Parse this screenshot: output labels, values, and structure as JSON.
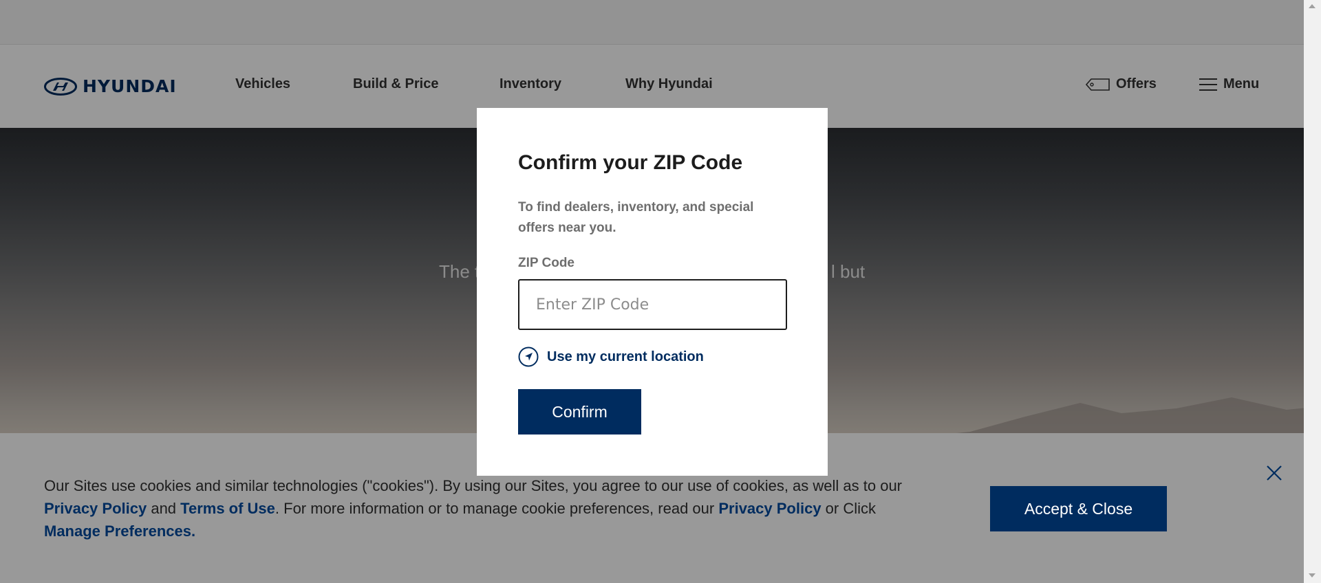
{
  "header": {
    "brand": "HYUNDAI",
    "nav": [
      "Vehicles",
      "Build & Price",
      "Inventory",
      "Why Hyundai"
    ],
    "offers": "Offers",
    "menu": "Menu"
  },
  "hero": {
    "left_text": "The t",
    "right_text": "l but"
  },
  "modal": {
    "title": "Confirm your ZIP Code",
    "description": "To find dealers, inventory, and special offers near you.",
    "zip_label": "ZIP Code",
    "zip_placeholder": "Enter ZIP Code",
    "zip_value": "",
    "location_link": "Use my current location",
    "confirm_label": "Confirm"
  },
  "cookie": {
    "t1": "Our Sites use cookies and similar technologies (\"cookies\"). By using our Sites, you agree to our use of cookies, as well as to our ",
    "privacy1": "Privacy Policy",
    "t2": " and ",
    "terms": "Terms of Use",
    "t3": ". For more information or to manage cookie preferences, read our ",
    "privacy2": "Privacy Policy",
    "t4": " or Click ",
    "manage": "Manage Preferences.",
    "accept_label": "Accept & Close"
  },
  "colors": {
    "brand_navy": "#002c5f",
    "overlay": "rgba(0,0,0,0.4)"
  }
}
